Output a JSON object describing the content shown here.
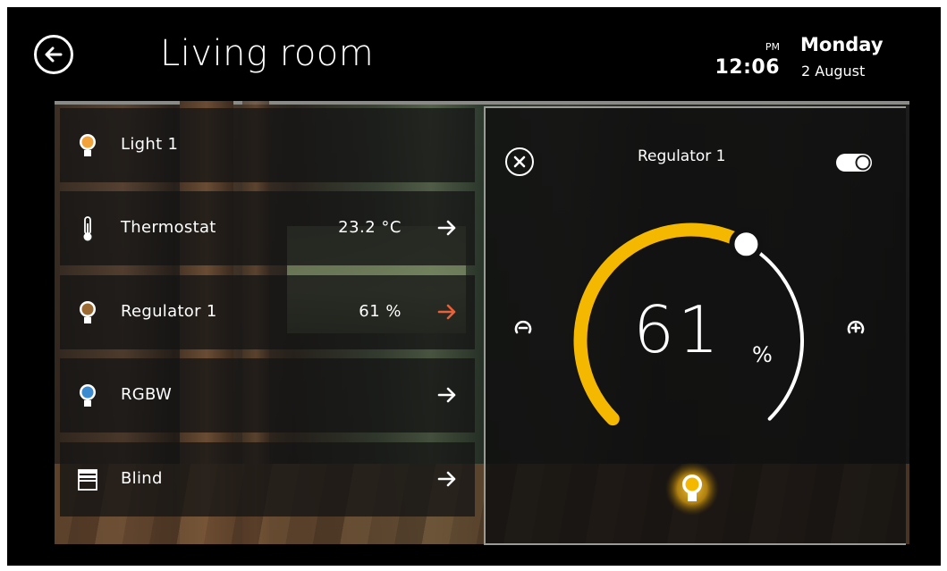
{
  "header": {
    "title": "Living room",
    "ampm": "PM",
    "time": "12:06",
    "weekday": "Monday",
    "date": "2 August"
  },
  "devices": [
    {
      "label": "Light 1",
      "value": "",
      "icon": "bulb-icon",
      "color": "#f2a23a"
    },
    {
      "label": "Thermostat",
      "value": "23.2 °C",
      "icon": "thermometer-icon"
    },
    {
      "label": "Regulator 1",
      "value": "61 %",
      "icon": "bulb-icon",
      "color": "#9b6a33",
      "arrow_color": "#e8613a"
    },
    {
      "label": "RGBW",
      "value": "",
      "icon": "bulb-icon",
      "color": "#3c8ad0"
    },
    {
      "label": "Blind",
      "value": "",
      "icon": "blind-icon"
    }
  ],
  "regulator": {
    "title": "Regulator 1",
    "value": "61",
    "unit": "%",
    "level": 0.61,
    "toggle_on": true,
    "accent": "#f5b800"
  }
}
